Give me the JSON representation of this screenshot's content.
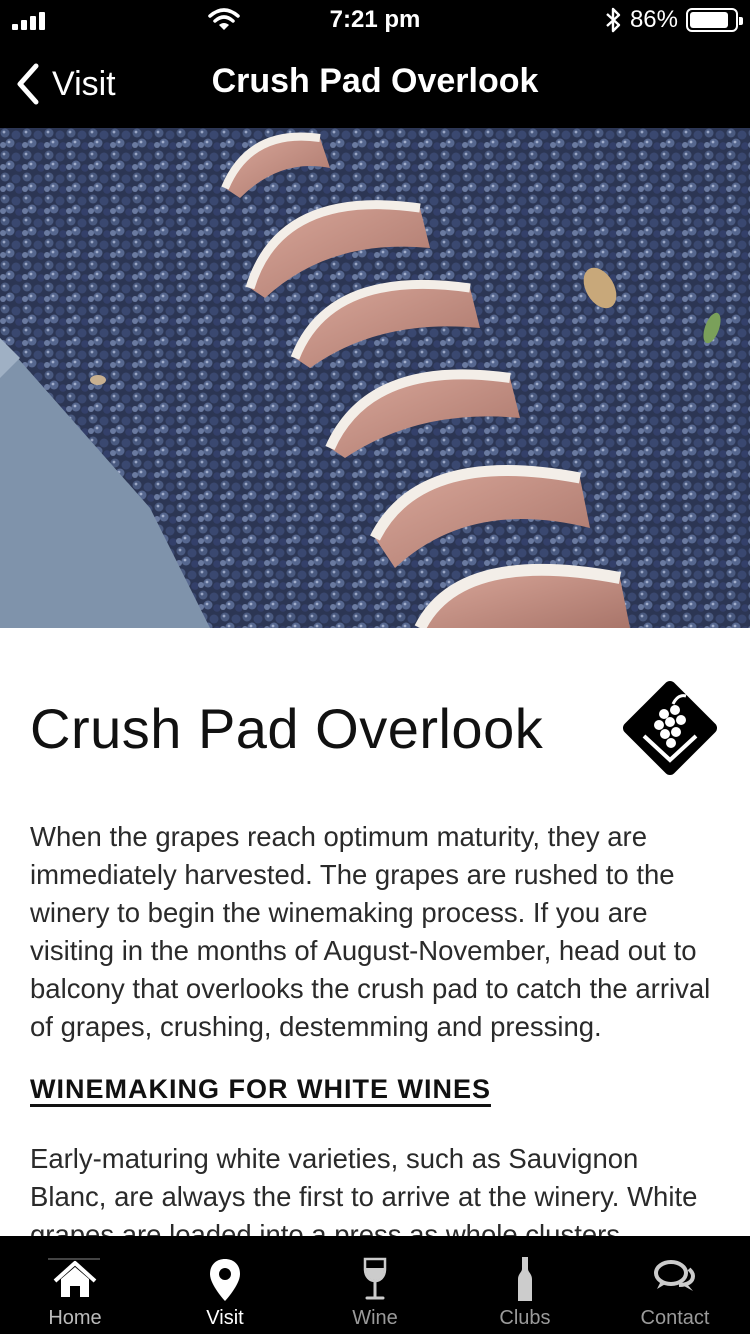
{
  "status_bar": {
    "time": "7:21 pm",
    "battery": "86%",
    "battery_level": 0.86
  },
  "nav": {
    "back_label": "Visit",
    "title": "Crush Pad Overlook"
  },
  "main": {
    "heading": "Crush Pad Overlook",
    "badge_icon": "grapes-diamond-icon",
    "paragraph_1": "When the grapes reach optimum maturity, they are immediately harvested. The grapes are rushed to the winery to begin the winemaking process. If you are visiting in the months of August-November, head out to balcony that overlooks the crush pad to catch the arrival of grapes, crushing, destemming and pressing.",
    "section_heading": "WINEMAKING FOR WHITE WINES",
    "paragraph_2": "Early-maturing white varieties, such as Sauvignon Blanc, are always the first to arrive at the winery. White grapes are loaded into a press as whole clusters"
  },
  "tabs": [
    {
      "label": "Home",
      "icon": "home-icon"
    },
    {
      "label": "Visit",
      "icon": "map-pin-icon",
      "active": true
    },
    {
      "label": "Wine",
      "icon": "wine-glass-icon"
    },
    {
      "label": "Clubs",
      "icon": "bottle-icon"
    },
    {
      "label": "Contact",
      "icon": "chat-bubbles-icon"
    }
  ],
  "colors": {
    "bar_background": "#000000",
    "content_background": "#ffffff",
    "inactive_tab_text": "#9a9a9a",
    "active_tab_text": "#ffffff"
  }
}
